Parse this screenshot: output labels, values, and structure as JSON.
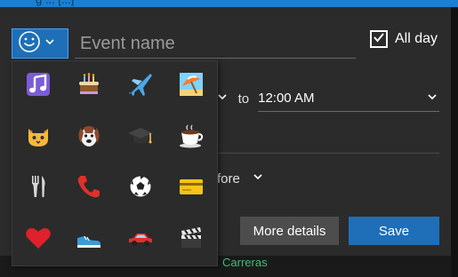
{
  "header": {
    "partial_text": "g ... [...]"
  },
  "event": {
    "title_placeholder": "Event name",
    "all_day_label": "All day",
    "all_day_checked": true
  },
  "time": {
    "to_label": "to",
    "end_time": "12:00 AM"
  },
  "reminder": {
    "text_fragment": "fore"
  },
  "buttons": {
    "more_details": "More details",
    "save": "Save"
  },
  "background_calendar": {
    "partial_text": "Carreras"
  },
  "emoji_picker": {
    "items": [
      "music-note",
      "birthday-cake",
      "airplane",
      "beach-umbrella",
      "cat-face",
      "dog-face",
      "graduation-cap",
      "coffee",
      "fork-and-knife",
      "telephone",
      "soccer-ball",
      "credit-card",
      "heart",
      "sneaker",
      "car",
      "clapper-board"
    ]
  },
  "colors": {
    "accent": "#1e6fb8",
    "panel": "#2b2b2b",
    "green_text": "#3fbf7a"
  }
}
